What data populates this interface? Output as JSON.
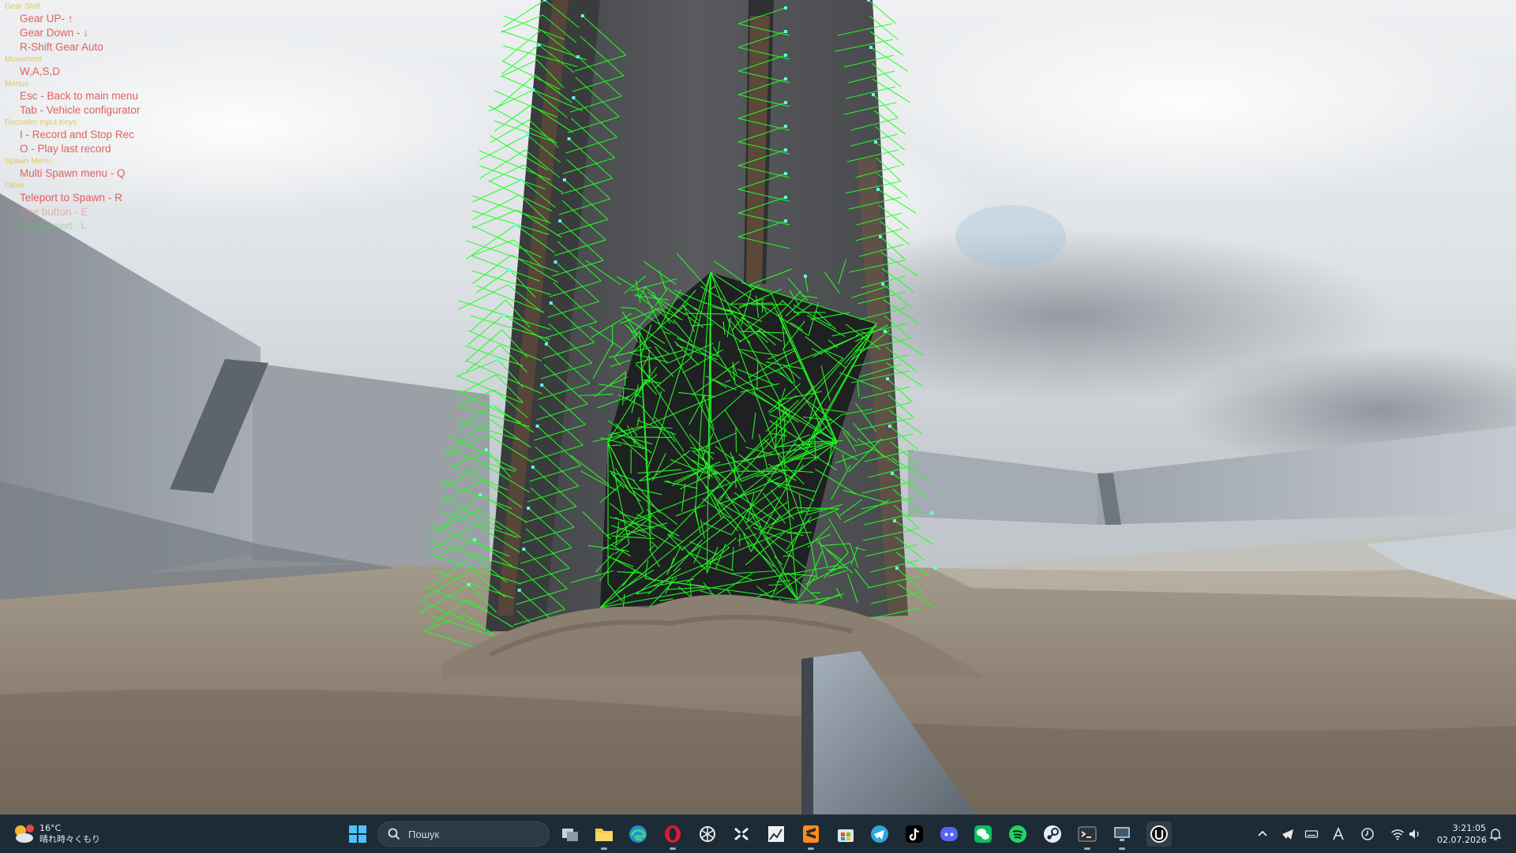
{
  "hud": {
    "sections": [
      {
        "title": "Gear Shift",
        "items": [
          {
            "text": "Gear UP- ↑",
            "style": "normal"
          },
          {
            "text": "Gear Down - ↓",
            "style": "normal"
          },
          {
            "text": "R-Shift Gear Auto",
            "style": "normal"
          }
        ]
      },
      {
        "title": "Movement",
        "items": [
          {
            "text": "W,A,S,D",
            "style": "normal"
          }
        ]
      },
      {
        "title": "Menus",
        "items": [
          {
            "text": "Esc -  Back to main menu",
            "style": "normal"
          },
          {
            "text": "Tab - Vehicle configurator",
            "style": "normal"
          }
        ]
      },
      {
        "title": "Recorder Input Keys",
        "items": [
          {
            "text": "I - Record and Stop Rec",
            "style": "normal"
          },
          {
            "text": "O - Play last record",
            "style": "normal"
          }
        ]
      },
      {
        "title": "Spawn Menu",
        "items": [
          {
            "text": "Multi Spawn menu - Q",
            "style": "normal"
          }
        ]
      },
      {
        "title": "Other",
        "items": [
          {
            "text": "Teleport to Spawn - R",
            "style": "normal"
          },
          {
            "text": "Use button - E",
            "style": "pale"
          },
          {
            "text": "Fast teleport - L",
            "style": "green"
          }
        ]
      }
    ]
  },
  "taskbar": {
    "weather": {
      "temp": "16°C",
      "desc": "晴れ時々くもり",
      "icon": "partly-cloudy-icon"
    },
    "search_placeholder": "Пошук",
    "apps": [
      {
        "name": "start-button",
        "icon": "windows-logo-icon"
      },
      {
        "name": "task-view-button",
        "icon": "task-view-icon"
      },
      {
        "name": "file-explorer",
        "icon": "folder-icon"
      },
      {
        "name": "edge",
        "icon": "edge-icon"
      },
      {
        "name": "opera",
        "icon": "opera-icon"
      },
      {
        "name": "chatgpt",
        "icon": "chatgpt-icon"
      },
      {
        "name": "capcut",
        "icon": "capcut-icon"
      },
      {
        "name": "photo-editor",
        "icon": "chart-app-icon"
      },
      {
        "name": "sublime-text",
        "icon": "sublime-icon"
      },
      {
        "name": "ms-store",
        "icon": "store-icon"
      },
      {
        "name": "telegram",
        "icon": "telegram-icon"
      },
      {
        "name": "tiktok",
        "icon": "tiktok-icon"
      },
      {
        "name": "discord",
        "icon": "discord-icon"
      },
      {
        "name": "wechat",
        "icon": "wechat-icon"
      },
      {
        "name": "spotify",
        "icon": "spotify-icon"
      },
      {
        "name": "steam",
        "icon": "steam-icon"
      },
      {
        "name": "terminal",
        "icon": "terminal-icon"
      },
      {
        "name": "remote-desktop",
        "icon": "monitor-icon"
      },
      {
        "name": "unreal-engine",
        "icon": "unreal-icon"
      }
    ],
    "tray": [
      "chevron-up-icon",
      "telegram-tray-icon",
      "keyboard-icon",
      "ime-a-icon",
      "clock-tray-icon",
      "wifi-icon",
      "volume-icon"
    ],
    "time": "3:21:05",
    "date": "02.07.2026"
  },
  "colors": {
    "wireframe": "#22ff22",
    "taskbar_bg": "#1c2b36",
    "hud_title": "#d9c44a",
    "hud_item": "#e06060"
  }
}
